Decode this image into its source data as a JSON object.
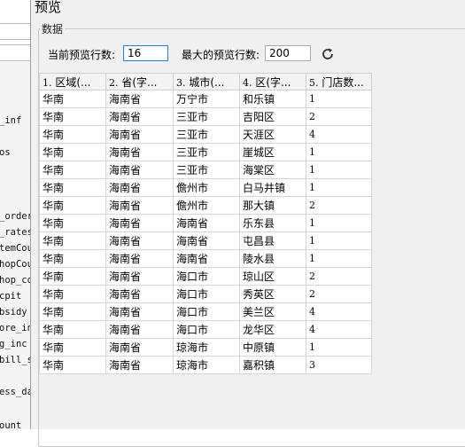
{
  "dialog": {
    "title": "预览"
  },
  "group": {
    "label": "数据"
  },
  "controls": {
    "current_rows_label": "当前预览行数:",
    "current_rows_value": "16",
    "max_rows_label": "最大的预览行数:",
    "max_rows_value": "200"
  },
  "table": {
    "columns": [
      {
        "idx": "1.",
        "label": "区域(..."
      },
      {
        "idx": "2.",
        "label": "省(字..."
      },
      {
        "idx": "3.",
        "label": "城市(..."
      },
      {
        "idx": "4.",
        "label": "区(字..."
      },
      {
        "idx": "5.",
        "label": "门店数..."
      }
    ],
    "rows": [
      [
        "华南",
        "海南省",
        "万宁市",
        "和乐镇",
        "1"
      ],
      [
        "华南",
        "海南省",
        "三亚市",
        "吉阳区",
        "2"
      ],
      [
        "华南",
        "海南省",
        "三亚市",
        "天涯区",
        "4"
      ],
      [
        "华南",
        "海南省",
        "三亚市",
        "崖城区",
        "1"
      ],
      [
        "华南",
        "海南省",
        "三亚市",
        "海棠区",
        "1"
      ],
      [
        "华南",
        "海南省",
        "儋州市",
        "白马井镇",
        "1"
      ],
      [
        "华南",
        "海南省",
        "儋州市",
        "那大镇",
        "2"
      ],
      [
        "华南",
        "海南省",
        "海南省",
        "乐东县",
        "1"
      ],
      [
        "华南",
        "海南省",
        "海南省",
        "屯昌县",
        "1"
      ],
      [
        "华南",
        "海南省",
        "海南省",
        "陵水县",
        "1"
      ],
      [
        "华南",
        "海南省",
        "海口市",
        "琼山区",
        "2"
      ],
      [
        "华南",
        "海南省",
        "海口市",
        "秀英区",
        "2"
      ],
      [
        "华南",
        "海南省",
        "海口市",
        "美兰区",
        "4"
      ],
      [
        "华南",
        "海南省",
        "海口市",
        "龙华区",
        "4"
      ],
      [
        "华南",
        "海南省",
        "琼海市",
        "中原镇",
        "1"
      ],
      [
        "华南",
        "海南省",
        "琼海市",
        "嘉积镇",
        "3"
      ]
    ]
  },
  "background_list": {
    "items": [
      "_inf",
      "os",
      "_order",
      "_rates",
      "temCoun",
      "hopCoun",
      "hop_cou",
      "cpit",
      "bsidy",
      "ore_in",
      "g_inc",
      "bill_s",
      "ess_dat",
      "ount"
    ]
  }
}
